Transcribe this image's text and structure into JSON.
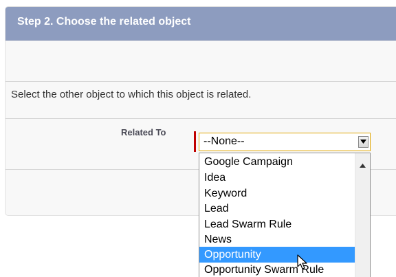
{
  "panel": {
    "title": "Step 2. Choose the related object",
    "description": "Select the other object to which this object is related."
  },
  "field": {
    "label": "Related To",
    "selected_value": "--None--",
    "required_color": "#c00000"
  },
  "dropdown": {
    "options": [
      "Google Campaign",
      "Idea",
      "Keyword",
      "Lead",
      "Lead Swarm Rule",
      "News",
      "Opportunity",
      "Opportunity Swarm Rule"
    ],
    "highlighted": "Opportunity"
  },
  "colors": {
    "header_bg": "#8d9cbf",
    "highlight": "#3399ff",
    "focus_border": "#e0a500"
  },
  "icons": {
    "select_arrow": "chevron-down-icon",
    "scroll_up": "scroll-up-arrow-icon",
    "cursor": "mouse-pointer-icon"
  }
}
